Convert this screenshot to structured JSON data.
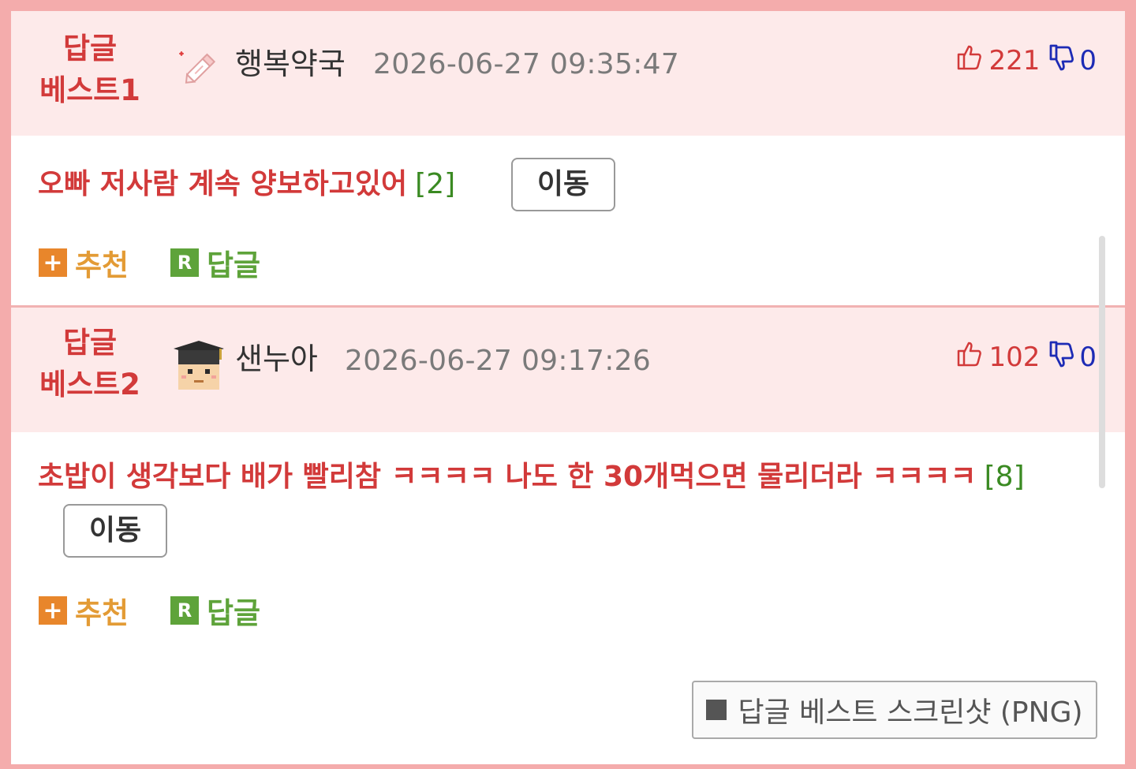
{
  "best": [
    {
      "badge_line1": "답글",
      "badge_line2": "베스트1",
      "nickname": "행복약국",
      "datetime": "2026-06-27 09:35:47",
      "up_votes": "221",
      "down_votes": "0",
      "comment": "오빠 저사람 계속 양보하고있어",
      "reply_count": "[2]",
      "move_label": "이동",
      "recommend_label": "추천",
      "reply_label": "답글",
      "avatar_icon": "pencil-icon"
    },
    {
      "badge_line1": "답글",
      "badge_line2": "베스트2",
      "nickname": "샌누아",
      "datetime": "2026-06-27 09:17:26",
      "up_votes": "102",
      "down_votes": "0",
      "comment": "초밥이 생각보다 배가 빨리참 ㅋㅋㅋㅋ 나도 한 30개먹으면 물리더라 ㅋㅋㅋㅋ",
      "reply_count": "[8]",
      "move_label": "이동",
      "recommend_label": "추천",
      "reply_label": "답글",
      "avatar_icon": "graduate-icon"
    }
  ],
  "plus_glyph": "+",
  "r_glyph": "R",
  "screenshot_button": "답글 베스트 스크린샷 (PNG)",
  "colors": {
    "frame": "#f4acac",
    "header_bg": "#fdeaea",
    "accent_red": "#d23a3a",
    "reply_count_green": "#3a8a22",
    "downvote_blue": "#1d2bb5",
    "recommend_orange": "#e8862b",
    "reply_green": "#5ea33a"
  }
}
